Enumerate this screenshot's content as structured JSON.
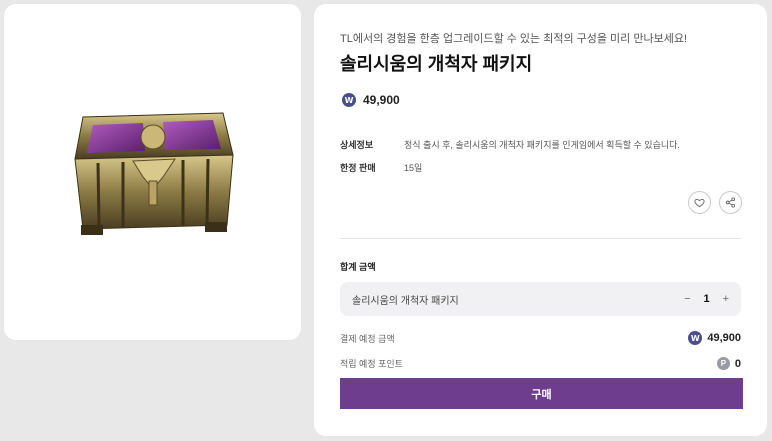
{
  "product": {
    "subtitle": "TL에서의 경험을 한층 업그레이드할 수 있는 최적의 구성을 미리 만나보세요!",
    "title": "솔리시움의 개척자 패키지",
    "price": "49,900",
    "currency_icon": "w-coin-icon",
    "currency_glyph": "W",
    "image_icon": "treasure-chest-image"
  },
  "details": [
    {
      "label": "상세정보",
      "value": "정식 출시 후, 솔리시움의 개척자 패키지를 인게임에서 획득할 수 있습니다."
    },
    {
      "label": "한정 판매",
      "value": "15일"
    }
  ],
  "actions": {
    "favorite_icon": "heart-icon",
    "share_icon": "share-icon"
  },
  "order": {
    "total_label": "합계 금액",
    "item_name": "솔리시움의 개척자 패키지",
    "minus": "−",
    "quantity": "1",
    "plus": "+",
    "payment_label": "결제 예정 금액",
    "payment_value": "49,900",
    "points_label": "적립 예정 포인트",
    "points_glyph": "P",
    "points_value": "0",
    "buy_label": "구매"
  },
  "colors": {
    "accent": "#6e3d8e",
    "coin": "#4a4f8c",
    "background": "#e8e8e8"
  }
}
